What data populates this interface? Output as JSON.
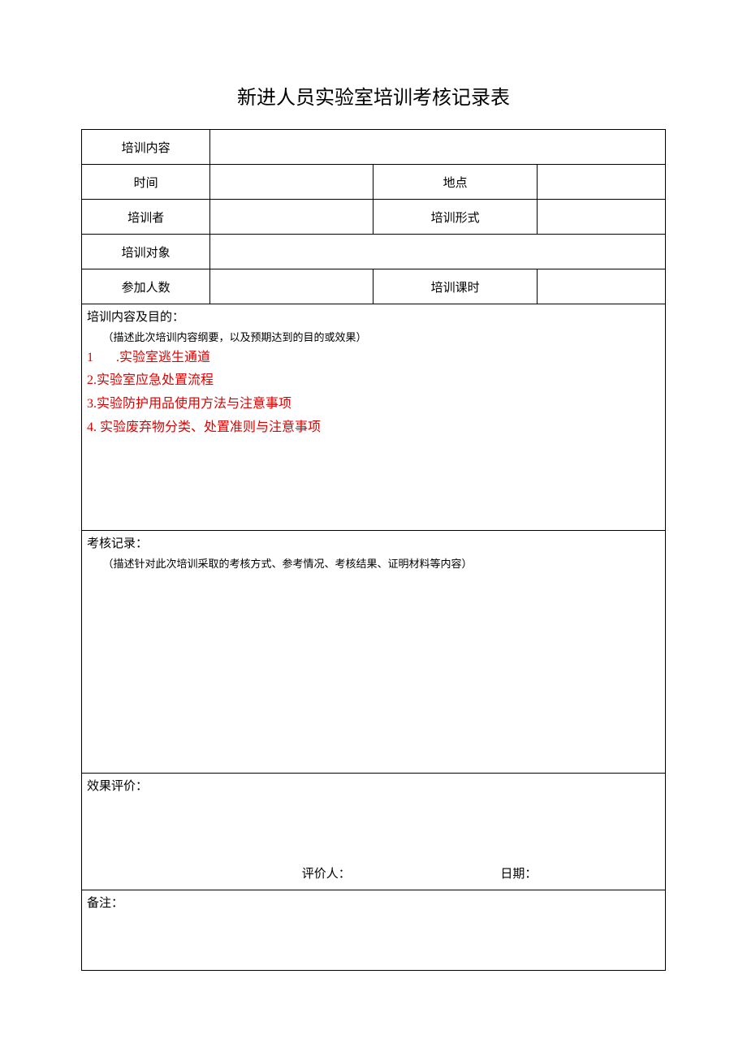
{
  "title": "新进人员实验室培训考核记录表",
  "labels": {
    "training_content": "培训内容",
    "time": "时间",
    "place": "地点",
    "trainer": "培训者",
    "training_form": "培训形式",
    "trainee": "培训对象",
    "attendance": "参加人数",
    "training_hours": "培训课时",
    "content_section_title": "培训内容及目的：",
    "content_section_hint": "（描述此次培训内容纲要，以及预期达到的目的或效果）",
    "record_section_title": "考核记录：",
    "record_section_hint": "（描述针对此次培训采取的考核方式、参考情况、考核结果、证明材料等内容）",
    "eval_section_title": "效果评价：",
    "eval_person": "评价人：",
    "eval_date": "日期：",
    "note_title": "备注："
  },
  "values": {
    "training_content": "",
    "time": "",
    "place": "",
    "trainer": "",
    "training_form": "",
    "trainee": "",
    "attendance": "",
    "training_hours": "",
    "eval_person": "",
    "eval_date": "",
    "note": ""
  },
  "content_items": [
    {
      "idx": "1",
      "sep": "       .",
      "text": "实验室逃生通道"
    },
    {
      "idx": "2.",
      "sep": "",
      "text": "实验室应急处置流程"
    },
    {
      "idx": "3.",
      "sep": "",
      "text": "实验防护用品使用方法与注意事项"
    },
    {
      "idx": "4.",
      "sep": " ",
      "text": "实验废弃物分类、处置准则与注意事项"
    }
  ]
}
